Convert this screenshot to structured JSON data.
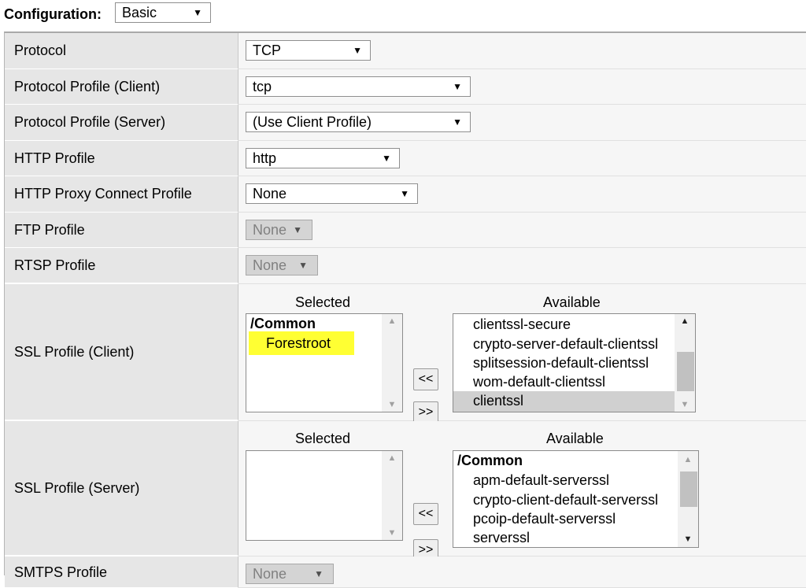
{
  "configuration": {
    "label": "Configuration:",
    "value": "Basic"
  },
  "rows": {
    "protocol": {
      "label": "Protocol",
      "value": "TCP"
    },
    "protocol_client": {
      "label": "Protocol Profile (Client)",
      "value": "tcp"
    },
    "protocol_server": {
      "label": "Protocol Profile (Server)",
      "value": "(Use Client Profile)"
    },
    "http": {
      "label": "HTTP Profile",
      "value": "http"
    },
    "http_proxy": {
      "label": "HTTP Proxy Connect Profile",
      "value": "None"
    },
    "ftp": {
      "label": "FTP Profile",
      "value": "None"
    },
    "rtsp": {
      "label": "RTSP Profile",
      "value": "None"
    },
    "ssl_client": {
      "label": "SSL Profile (Client)",
      "selected_caption": "Selected",
      "available_caption": "Available",
      "selected_group": "/Common",
      "selected_items": [
        "Forestroot"
      ],
      "available_items": [
        "clientssl-secure",
        "crypto-server-default-clientssl",
        "splitsession-default-clientssl",
        "wom-default-clientssl",
        "clientssl"
      ],
      "move_left": "<<",
      "move_right": ">>"
    },
    "ssl_server": {
      "label": "SSL Profile (Server)",
      "selected_caption": "Selected",
      "available_caption": "Available",
      "available_group": "/Common",
      "available_items": [
        "apm-default-serverssl",
        "crypto-client-default-serverssl",
        "pcoip-default-serverssl",
        "serverssl"
      ],
      "move_left": "<<",
      "move_right": ">>"
    },
    "smtps": {
      "label": "SMTPS Profile",
      "value": "None"
    }
  },
  "icons": {
    "dropdown": "triangle-down-icon",
    "scroll_up": "scroll-up-arrow",
    "scroll_down": "scroll-down-arrow"
  },
  "colors": {
    "label_bg": "#e6e6e6",
    "value_bg": "#f6f6f6",
    "highlight": "#ffff33",
    "disabled_bg": "#d4d4d4"
  }
}
